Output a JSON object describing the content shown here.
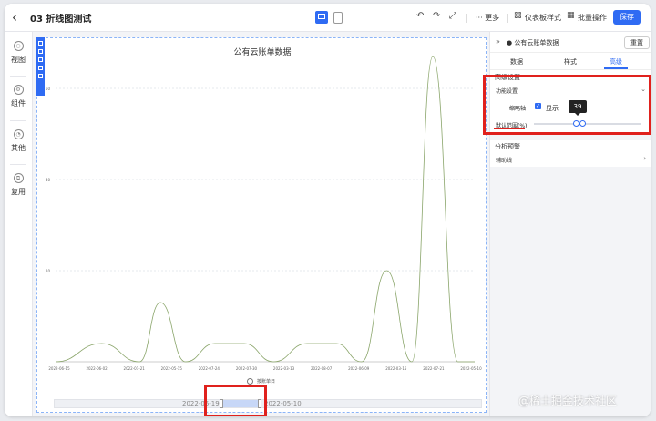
{
  "header": {
    "back_icon": "chevron-left-icon",
    "title": "03 折线图测试",
    "more": "··· 更多",
    "dashboard_style": "仪表板样式",
    "batch_ops": "批量操作",
    "save": "保存"
  },
  "rail": {
    "items": [
      {
        "label": "视图",
        "icon": "view-icon"
      },
      {
        "label": "组件",
        "icon": "component-icon"
      },
      {
        "label": "其他",
        "icon": "other-icon"
      },
      {
        "label": "复用",
        "icon": "reuse-icon"
      }
    ]
  },
  "panel": {
    "title": "公有云账单数据",
    "reset": "重置",
    "tabs": [
      "数据",
      "样式",
      "高级"
    ],
    "active_tab": 2,
    "advanced_settings": "高级设置",
    "function_settings": "功能设置",
    "thumbnail_axis": "缩略轴",
    "show": "显示",
    "default_range": "默认范围(%)",
    "tooltip_value": "39",
    "slider_range_percent": [
      39,
      45
    ],
    "analysis_alert": "分析预警",
    "aux_line": "辅助线"
  },
  "zoom": {
    "start_label": "2022-06-19",
    "end_label": "2022-05-10",
    "range_fraction": [
      0.39,
      0.48
    ]
  },
  "colors": {
    "accent": "#2f6bf3",
    "highlight": "#e0211d",
    "line": "#8aa56a"
  },
  "watermark": "@稀土掘金技术社区",
  "chart_data": {
    "type": "line",
    "title": "公有云账单数据",
    "legend": [
      "按账单日"
    ],
    "ylim": [
      0,
      65
    ],
    "yticks": [
      20,
      40,
      60
    ],
    "x": [
      "2022-06-15",
      "2022-06-02",
      "2022-01-21",
      "2022-05-15",
      "2022-07-24",
      "2022-07-30",
      "2022-03-13",
      "2022-08-07",
      "2022-06-09",
      "2022-03-15",
      "2022-07-21",
      "2022-05-10"
    ],
    "series": [
      {
        "values": [
          0,
          4,
          0,
          13,
          0,
          4,
          4,
          0,
          4,
          4,
          0,
          20,
          0,
          67,
          0,
          0
        ],
        "x_positions": [
          0.0,
          0.11,
          0.2,
          0.25,
          0.31,
          0.38,
          0.45,
          0.52,
          0.6,
          0.67,
          0.73,
          0.79,
          0.85,
          0.9,
          0.96,
          1.0
        ]
      }
    ]
  }
}
